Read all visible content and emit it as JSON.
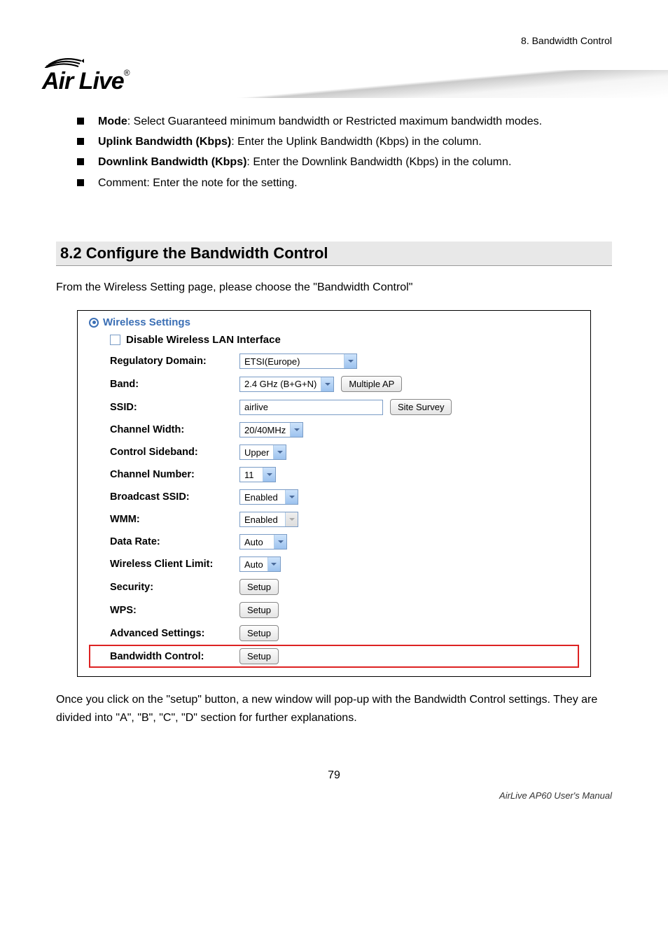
{
  "header": {
    "chapter": "8. Bandwidth Control",
    "logo_text": "Air Live"
  },
  "bullets": {
    "mode_label": "Mode",
    "mode_text": ": Select Guaranteed minimum bandwidth or Restricted maximum bandwidth modes.",
    "uplink_label": "Uplink Bandwidth (Kbps)",
    "uplink_text": ": Enter the Uplink Bandwidth (Kbps) in the column.",
    "downlink_label": "Downlink Bandwidth (Kbps)",
    "downlink_text": ": Enter the Downlink Bandwidth (Kbps) in the column.",
    "comment_text": "Comment: Enter the note for the setting."
  },
  "section": {
    "heading": "8.2 Configure the Bandwidth Control",
    "intro": "From the Wireless Setting page, please choose the \"Bandwidth Control\""
  },
  "panel": {
    "title": "Wireless Settings",
    "disable_label": "Disable Wireless LAN Interface",
    "regulatory_label": "Regulatory Domain:",
    "regulatory_value": "ETSI(Europe)",
    "band_label": "Band:",
    "band_value": "2.4 GHz (B+G+N)",
    "multiple_ap_btn": "Multiple AP",
    "ssid_label": "SSID:",
    "ssid_value": "airlive",
    "site_survey_btn": "Site Survey",
    "channel_width_label": "Channel Width:",
    "channel_width_value": "20/40MHz",
    "control_sideband_label": "Control Sideband:",
    "control_sideband_value": "Upper",
    "channel_number_label": "Channel Number:",
    "channel_number_value": "11",
    "broadcast_ssid_label": "Broadcast SSID:",
    "broadcast_ssid_value": "Enabled",
    "wmm_label": "WMM:",
    "wmm_value": "Enabled",
    "data_rate_label": "Data Rate:",
    "data_rate_value": "Auto",
    "client_limit_label": "Wireless Client Limit:",
    "client_limit_value": "Auto",
    "security_label": "Security:",
    "wps_label": "WPS:",
    "advanced_label": "Advanced Settings:",
    "bandwidth_label": "Bandwidth Control:",
    "setup_btn": "Setup"
  },
  "outro": "Once you click on the \"setup\" button, a new window will pop-up with the Bandwidth Control settings.   They are divided into \"A\", \"B\", \"C\", \"D\" section for further explanations.",
  "footer": {
    "page_num": "79",
    "manual": "AirLive AP60 User's Manual"
  }
}
